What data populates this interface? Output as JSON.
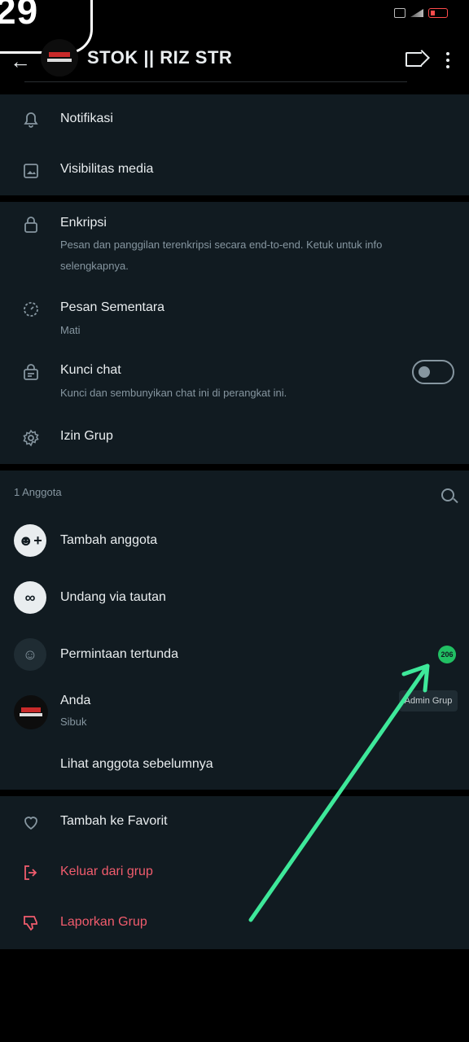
{
  "status_bar": {
    "time_fragment": "29"
  },
  "header": {
    "title": "STOK || RIZ STR"
  },
  "settings": {
    "notifications": "Notifikasi",
    "media_visibility": "Visibilitas media"
  },
  "security": {
    "encryption_title": "Enkripsi",
    "encryption_sub": "Pesan dan panggilan terenkripsi secara end-to-end. Ketuk untuk info selengkapnya.",
    "disappearing_title": "Pesan Sementara",
    "disappearing_sub": "Mati",
    "chat_lock_title": "Kunci chat",
    "chat_lock_sub": "Kunci dan sembunyikan chat ini di perangkat ini.",
    "chat_lock_on": false,
    "group_permissions": "Izin Grup"
  },
  "members": {
    "header": "1 Anggota",
    "add_member": "Tambah anggota",
    "invite_link": "Undang via tautan",
    "pending_requests": "Permintaan tertunda",
    "pending_count": "206",
    "you_name": "Anda",
    "you_status": "Sibuk",
    "admin_label": "Admin Grup",
    "view_past": "Lihat anggota sebelumnya"
  },
  "actions": {
    "add_favorite": "Tambah ke Favorit",
    "exit_group": "Keluar dari grup",
    "report_group": "Laporkan Grup"
  },
  "colors": {
    "panel": "#111b21",
    "accent_green": "#21c063",
    "danger_red": "#f15c6d",
    "annotation_arrow": "#3ee89a"
  }
}
